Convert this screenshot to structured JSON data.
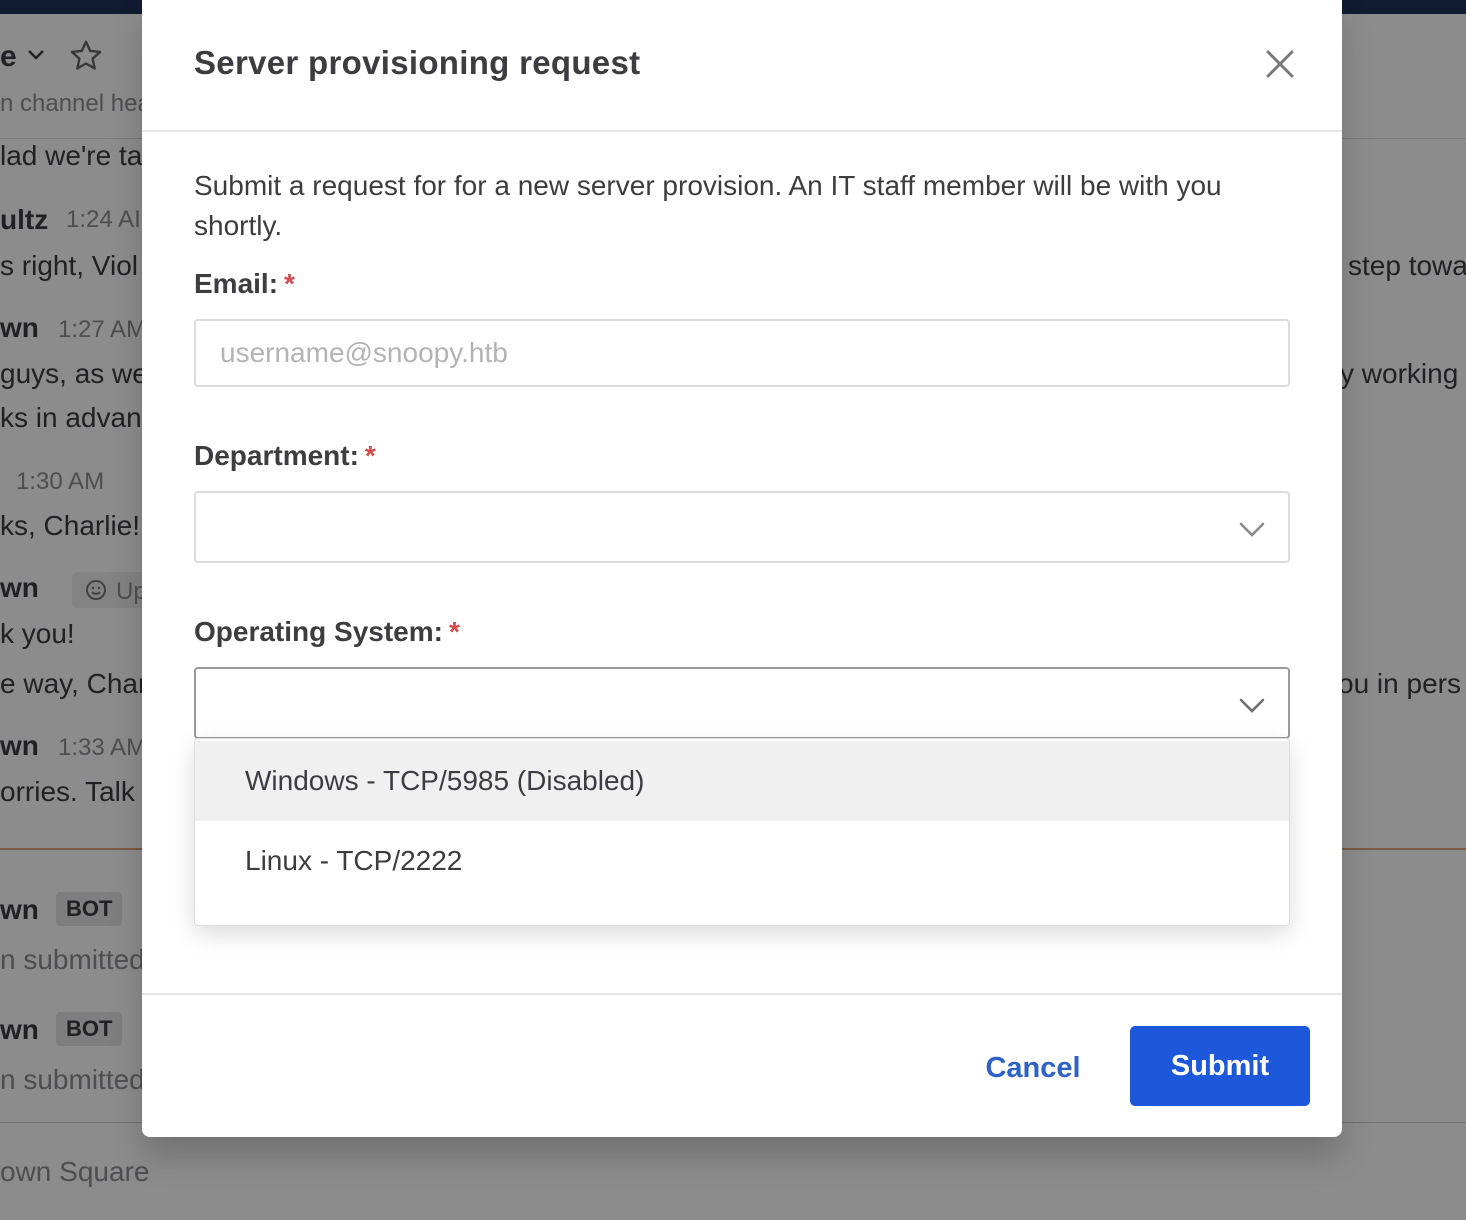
{
  "background": {
    "header": {
      "channel_name_fragment": "e",
      "channel_header_fragment": "n channel hea"
    },
    "messages": [
      {
        "kind": "text",
        "text": "lad we're ta"
      },
      {
        "kind": "author",
        "name": "ultz",
        "time": "1:24 AI"
      },
      {
        "kind": "text",
        "text": "s right, Viol",
        "right_text": "step towa"
      },
      {
        "kind": "author",
        "name": "wn",
        "time": "1:27 AM"
      },
      {
        "kind": "text",
        "text": "guys, as we",
        "right_text": "y working"
      },
      {
        "kind": "text",
        "text": "ks in advan"
      },
      {
        "kind": "author",
        "name": "",
        "time": "1:30 AM"
      },
      {
        "kind": "text",
        "text": "ks, Charlie!"
      },
      {
        "kind": "author",
        "name": "wn",
        "status_fragment": "Up"
      },
      {
        "kind": "text",
        "text": "k you!"
      },
      {
        "kind": "text",
        "text": "e way, Char",
        "right_text": "ou in pers"
      },
      {
        "kind": "author",
        "name": "wn",
        "time": "1:33 AM"
      },
      {
        "kind": "text",
        "text": "orries.  Talk"
      },
      {
        "kind": "author",
        "name": "wn",
        "badge": "BOT"
      },
      {
        "kind": "text",
        "text": "n submitted"
      },
      {
        "kind": "author",
        "name": "wn",
        "badge": "BOT"
      },
      {
        "kind": "text",
        "text": "n submitted"
      }
    ],
    "footer_placeholder": "own Square"
  },
  "modal": {
    "title": "Server provisioning request",
    "intro": "Submit a request for for a new server provision. An IT staff member will be with you shortly.",
    "required_marker": "*",
    "email": {
      "label": "Email:",
      "placeholder": "username@snoopy.htb",
      "value": ""
    },
    "department": {
      "label": "Department:",
      "selected": ""
    },
    "operating_system": {
      "label": "Operating System:",
      "selected": "",
      "options": [
        "Windows - TCP/5985 (Disabled)",
        "Linux - TCP/2222"
      ],
      "highlighted_index": 0
    },
    "cancel_label": "Cancel",
    "submit_label": "Submit"
  },
  "icons": {
    "close": "close-icon",
    "star": "star-icon",
    "chevron": "chevron-down-icon",
    "emoji": "emoji-icon"
  },
  "colors": {
    "primary": "#1c58d9",
    "link": "#2e62c7",
    "required": "#d24b4e",
    "text": "#3d3c40",
    "placeholder": "#b3b3b3",
    "option_hover": "#f0f0f0"
  }
}
